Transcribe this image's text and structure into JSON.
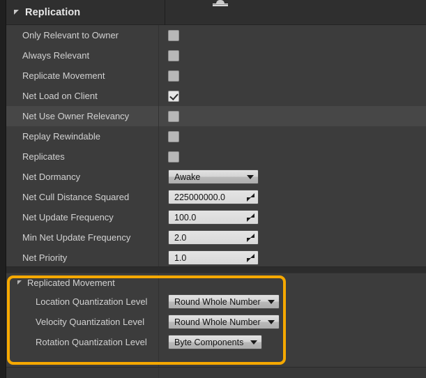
{
  "panel": {
    "category": {
      "title": "Replication",
      "expand_icon": "triangle-down-icon"
    },
    "rows": [
      {
        "label": "Only Relevant to Owner",
        "type": "checkbox",
        "checked": false,
        "highlighted": false
      },
      {
        "label": "Always Relevant",
        "type": "checkbox",
        "checked": false,
        "highlighted": false
      },
      {
        "label": "Replicate Movement",
        "type": "checkbox",
        "checked": false,
        "highlighted": false
      },
      {
        "label": "Net Load on Client",
        "type": "checkbox",
        "checked": true,
        "highlighted": false
      },
      {
        "label": "Net Use Owner Relevancy",
        "type": "checkbox",
        "checked": false,
        "highlighted": true
      },
      {
        "label": "Replay Rewindable",
        "type": "checkbox",
        "checked": false,
        "highlighted": false
      },
      {
        "label": "Replicates",
        "type": "checkbox",
        "checked": false,
        "highlighted": false
      },
      {
        "label": "Net Dormancy",
        "type": "combo",
        "value": "Awake",
        "highlighted": false
      },
      {
        "label": "Net Cull Distance Squared",
        "type": "number",
        "value": "225000000.0",
        "highlighted": false
      },
      {
        "label": "Net Update Frequency",
        "type": "number",
        "value": "100.0",
        "highlighted": false
      },
      {
        "label": "Min Net Update Frequency",
        "type": "number",
        "value": "2.0",
        "highlighted": false
      },
      {
        "label": "Net Priority",
        "type": "number",
        "value": "1.0",
        "highlighted": false
      }
    ],
    "group": {
      "title": "Replicated Movement",
      "expand_icon": "triangle-down-icon",
      "highlight_color": "#f5a800",
      "rows": [
        {
          "label": "Location Quantization Level",
          "type": "combo",
          "value": "Round Whole Number"
        },
        {
          "label": "Velocity Quantization Level",
          "type": "combo",
          "value": "Round Whole Number"
        },
        {
          "label": "Rotation Quantization Level",
          "type": "combo",
          "value": "Byte Components"
        }
      ]
    },
    "footer": {
      "drag_handle_icon": "splitter-drag-handle-icon"
    }
  }
}
